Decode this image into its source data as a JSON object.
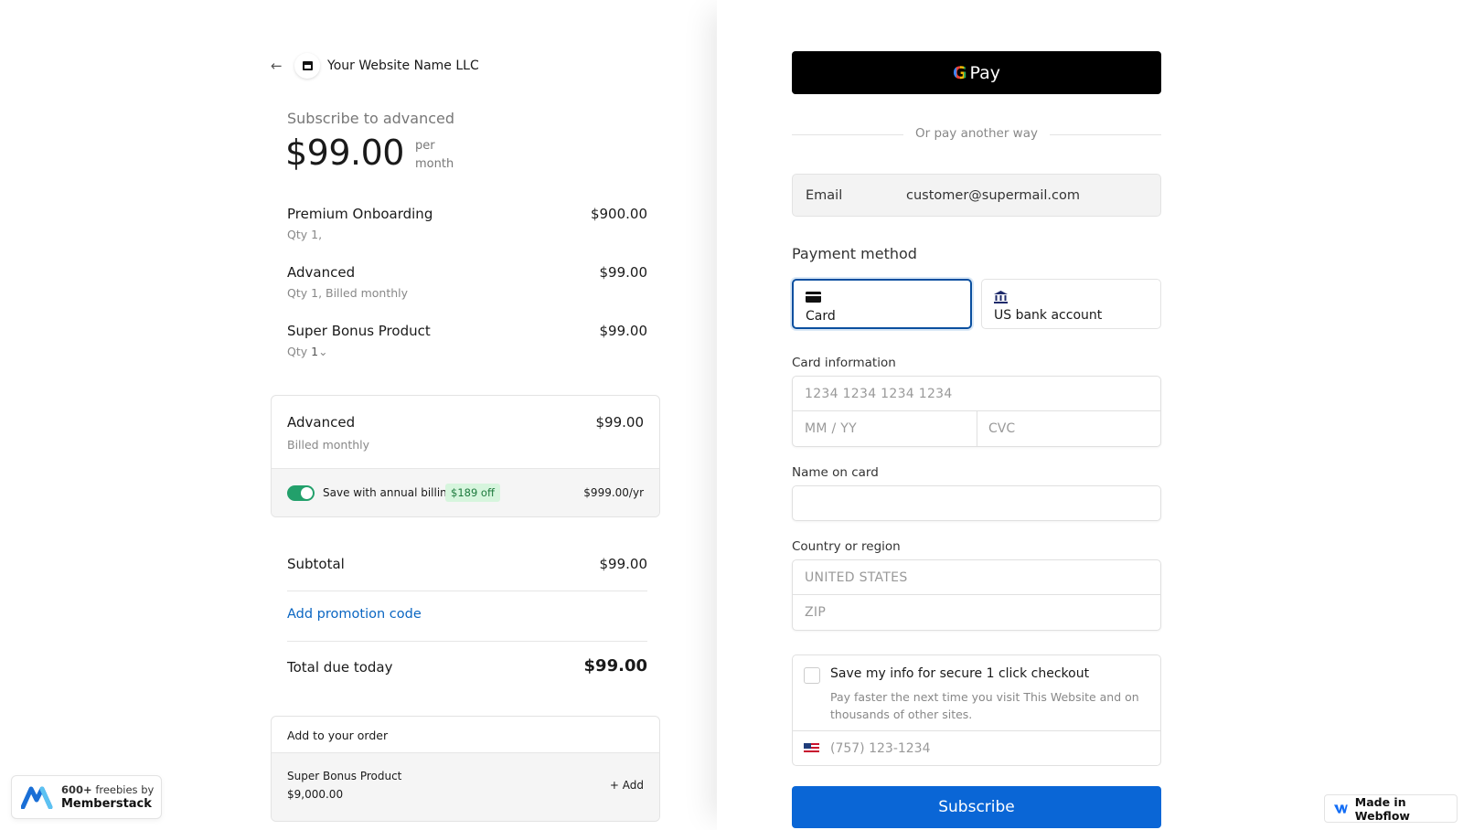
{
  "header": {
    "store_name": "Your Website Name LLC"
  },
  "summary": {
    "subscribe_to": "Subscribe to advanced",
    "price": "$99.00",
    "per": "per",
    "period": "month"
  },
  "line_items": [
    {
      "name": "Premium Onboarding",
      "amount": "$900.00",
      "sub": "Qty 1,"
    },
    {
      "name": "Advanced",
      "amount": "$99.00",
      "sub": "Qty 1, Billed monthly"
    },
    {
      "name": "Super Bonus Product",
      "amount": "$99.00",
      "qty_label": "Qty",
      "qty_value": "1"
    }
  ],
  "plan": {
    "name": "Advanced",
    "amount": "$99.00",
    "sub": "Billed monthly",
    "annual_label": "Save with annual billing",
    "discount": "$189 off",
    "annual_price": "$999.00/yr",
    "annual_enabled": true
  },
  "totals": {
    "subtotal_label": "Subtotal",
    "subtotal": "$99.00",
    "promo_link": "Add promotion code",
    "total_label": "Total due today",
    "total": "$99.00"
  },
  "addon": {
    "heading": "Add to your order",
    "name": "Super Bonus Product",
    "price": "$9,000.00",
    "add_label": "+ Add"
  },
  "memberstack_badge": {
    "count": "600+",
    "text": "freebies by",
    "brand": "Memberstack"
  },
  "checkout": {
    "gpay_label": "Pay",
    "or_text": "Or pay another way",
    "email_label": "Email",
    "email_value": "customer@supermail.com",
    "payment_method_title": "Payment method",
    "methods": [
      {
        "label": "Card",
        "icon": "card-icon",
        "selected": true
      },
      {
        "label": "US bank account",
        "icon": "bank-icon",
        "selected": false
      }
    ],
    "card_info_label": "Card information",
    "card_number_placeholder": "1234  1234  1234  1234",
    "expiry_placeholder": "MM / YY",
    "cvc_placeholder": "CVC",
    "name_label": "Name on card",
    "country_label": "Country or region",
    "country_value": "UNITED STATES",
    "zip_placeholder": "ZIP",
    "save_title": "Save my info for secure 1 click checkout",
    "save_desc": "Pay faster the next time you visit This Website and on thousands of other sites.",
    "phone_placeholder": "(757) 123-1234",
    "subscribe_label": "Subscribe"
  },
  "webflow_badge": {
    "text": "Made in Webflow"
  },
  "colors": {
    "primary": "#0a66d6",
    "link": "#0a66c2",
    "toggle_on": "#22a06b",
    "discount_bg": "#d6f5dd",
    "discount_text": "#1d7a3d"
  }
}
